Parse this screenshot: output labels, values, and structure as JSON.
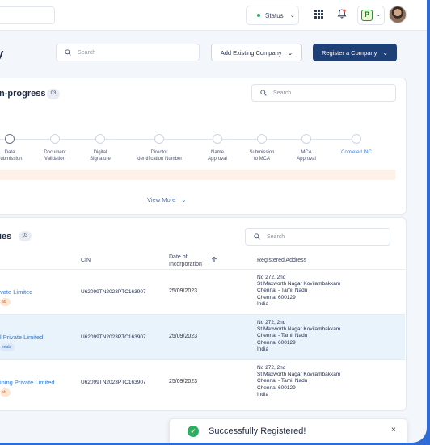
{
  "topbar": {
    "status_label": "Status",
    "brand_letter": "P",
    "icons": [
      "grid-icon",
      "bell-icon",
      "chevron-down-icon"
    ]
  },
  "header": {
    "title_fragment": "y",
    "search_placeholder": "Search",
    "add_existing_label": "Add Existing Company",
    "register_label": "Register a Company"
  },
  "in_progress": {
    "title_fragment": "n-progress",
    "count": "03",
    "search_placeholder": "Search",
    "steps": [
      {
        "label": "Data\nSubmission",
        "state": "current"
      },
      {
        "label": "Document\nValidation",
        "state": "pending"
      },
      {
        "label": "Digital\nSignature",
        "state": "pending"
      },
      {
        "label": "Director\nIdentification Number",
        "state": "pending"
      },
      {
        "label": "Name\nApproval",
        "state": "pending"
      },
      {
        "label": "Submission\nto MCA",
        "state": "pending"
      },
      {
        "label": "MCA\nApproval",
        "state": "pending"
      },
      {
        "label": "Comleted INC",
        "state": "done"
      }
    ],
    "view_more": "View More"
  },
  "companies": {
    "title_fragment": "ies",
    "count": "03",
    "search_placeholder": "Search",
    "columns": {
      "cin": "CIN",
      "date": "Date of\nIncorporation",
      "address": "Registered Address"
    },
    "rows": [
      {
        "name": "vate Limited",
        "tag": "ab",
        "tag_color": "orange",
        "cin": "U62099TN2023PTC163907",
        "date": "25/09/2023",
        "address": "No 272, 2nd\nSt Maxworth Nagar Kovilambakkam\nChennai - Tamil Nadu\nChennai 600129\nIndia"
      },
      {
        "name": "l Private Limited",
        "tag": "eeab",
        "tag_color": "blue",
        "cin": "U62099TN2023PTC163907",
        "date": "25/09/2023",
        "address": "No 272, 2nd\nSt Maxworth Nagar Kovilambakkam\nChennai - Tamil Nadu\nChennai 600129\nIndia"
      },
      {
        "name": "ining Private Limited",
        "tag": "ab",
        "tag_color": "orange",
        "cin": "U62099TN2023PTC163907",
        "date": "25/09/2023",
        "address": "No 272, 2nd\nSt Maxworth Nagar Kovilambakkam\nChennai - Tamil Nadu\nChennai 600129\nIndia"
      }
    ]
  },
  "toast": {
    "message": "Successfully Registered!",
    "close": "×"
  },
  "colors": {
    "accent": "#1f3f77",
    "link": "#2e7ad0",
    "success": "#2fae5f"
  }
}
